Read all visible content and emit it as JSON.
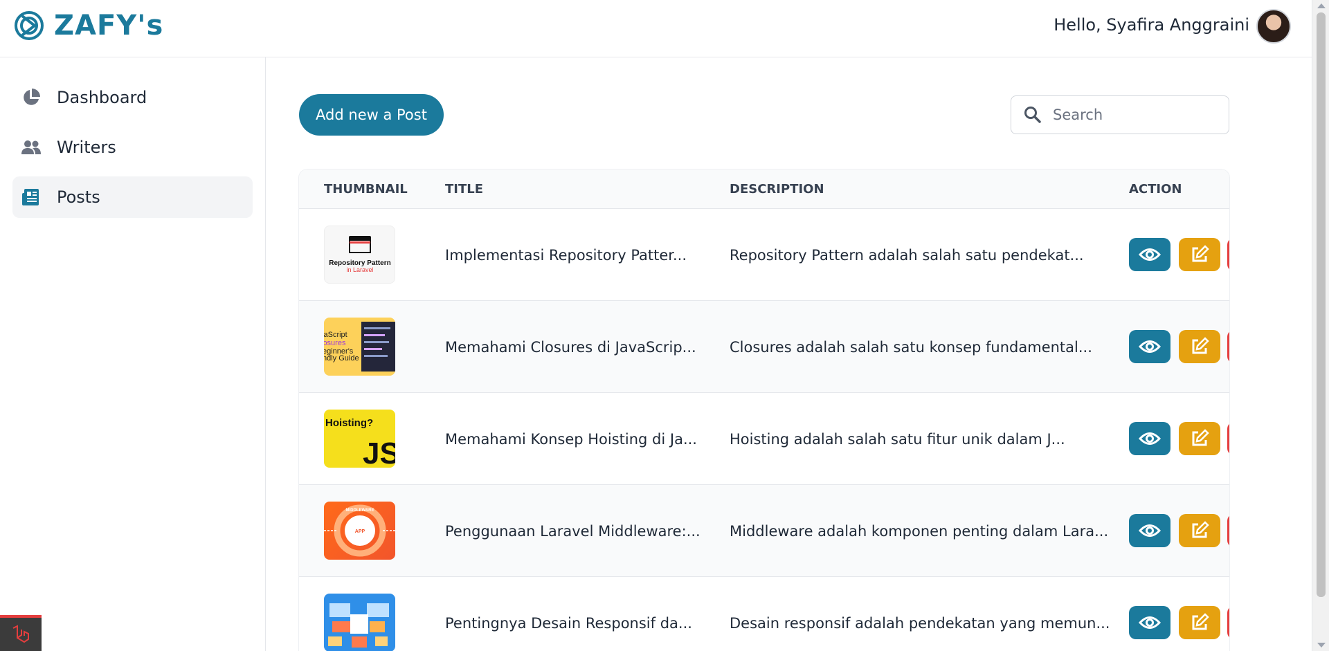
{
  "brand": {
    "name": "ZAFY's",
    "color": "#1b7a9c"
  },
  "header": {
    "greeting": "Hello, Syafira Anggraini"
  },
  "sidebar": {
    "items": [
      {
        "label": "Dashboard",
        "icon": "pie-chart-icon",
        "active": false
      },
      {
        "label": "Writers",
        "icon": "users-icon",
        "active": false
      },
      {
        "label": "Posts",
        "icon": "newspaper-icon",
        "active": true
      }
    ]
  },
  "toolbar": {
    "add_label": "Add new a Post",
    "search_placeholder": "Search"
  },
  "table": {
    "headers": {
      "thumbnail": "THUMBNAIL",
      "title": "TITLE",
      "description": "DESCRIPTION",
      "action": "ACTION"
    },
    "rows": [
      {
        "title": "Implementasi Repository Patter...",
        "description": "Repository Pattern adalah salah satu pendekat...",
        "thumb_caption": "Repository Pattern",
        "thumb_sub": "in Laravel"
      },
      {
        "title": "Memahami Closures di JavaScrip...",
        "description": "Closures adalah salah satu konsep fundamental...",
        "thumb_caption": "JavaScript Closures Beginner's Friendly Guide"
      },
      {
        "title": "Memahami Konsep Hoisting di Ja...",
        "description": "Hoisting adalah salah satu fitur unik dalam J...",
        "thumb_caption": "Hoisting?",
        "thumb_sub": "JS"
      },
      {
        "title": "Penggunaan Laravel Middleware:...",
        "description": "Middleware adalah komponen penting dalam Lara...",
        "thumb_caption": "MIDDLEWARE",
        "thumb_sub": "APP"
      },
      {
        "title": "Pentingnya Desain Responsif da...",
        "description": "Desain responsif adalah pendekatan yang memun..."
      }
    ]
  },
  "colors": {
    "primary": "#1b7a9c",
    "edit": "#e5a110",
    "delete": "#e53e3e"
  }
}
